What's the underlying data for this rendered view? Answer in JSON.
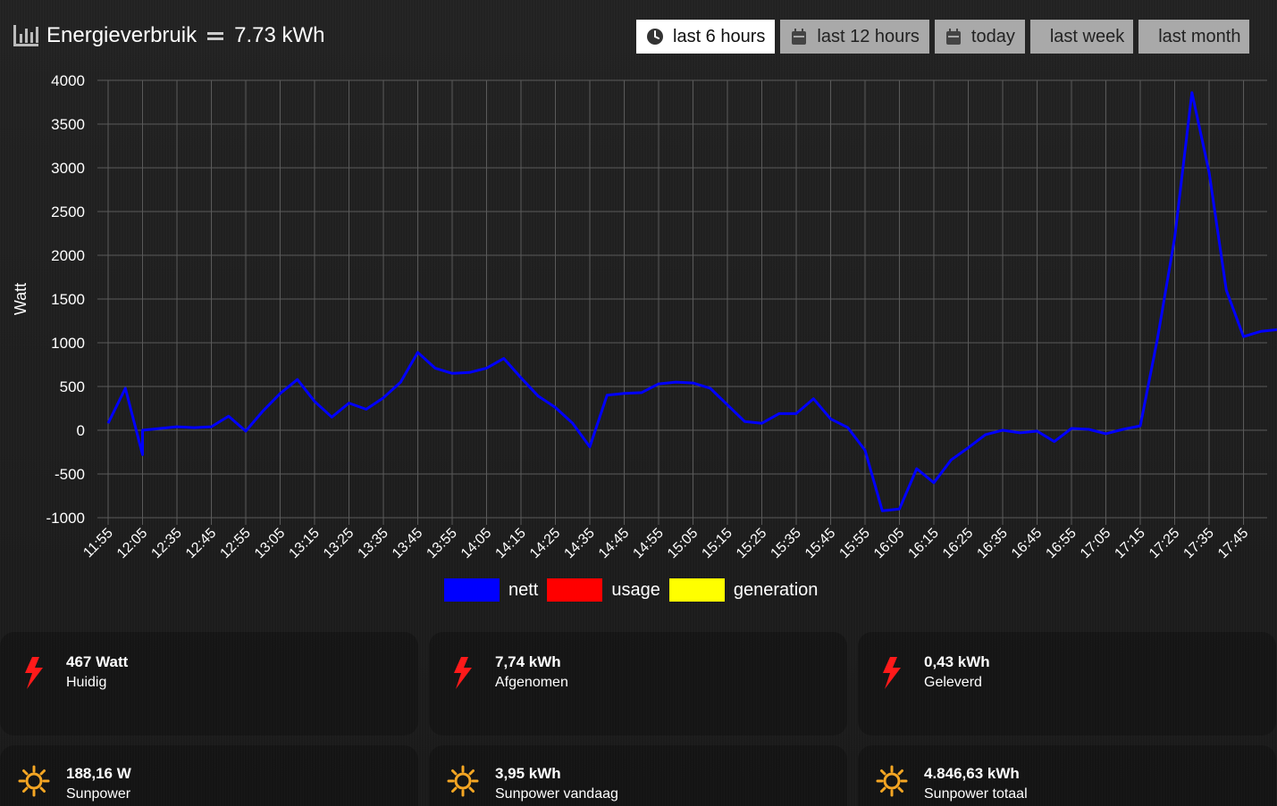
{
  "header": {
    "title": "Energieverbruik",
    "total": "7.73 kWh"
  },
  "range_buttons": [
    {
      "label": "last 6 hours",
      "icon": "clock-icon",
      "active": true
    },
    {
      "label": "last 12 hours",
      "icon": "calendar-icon",
      "active": false
    },
    {
      "label": "today",
      "icon": "calendar-icon",
      "active": false
    },
    {
      "label": "last week",
      "icon": "",
      "active": false
    },
    {
      "label": "last month",
      "icon": "",
      "active": false
    }
  ],
  "chart_data": {
    "type": "line",
    "ylabel": "Watt",
    "ylim": [
      -1000,
      4000
    ],
    "yticks": [
      4000,
      3500,
      3000,
      2500,
      2000,
      1500,
      1000,
      500,
      0,
      -500,
      -1000
    ],
    "xlabels": [
      "11:55",
      "12:05",
      "12:35",
      "12:45",
      "12:55",
      "13:05",
      "13:15",
      "13:25",
      "13:35",
      "13:45",
      "13:55",
      "14:05",
      "14:15",
      "14:25",
      "14:35",
      "14:45",
      "14:55",
      "15:05",
      "15:15",
      "15:25",
      "15:35",
      "15:45",
      "15:55",
      "16:05",
      "16:15",
      "16:25",
      "16:35",
      "16:45",
      "16:55",
      "17:05",
      "17:15",
      "17:25",
      "17:35",
      "17:45"
    ],
    "grid": true,
    "legend_position": "bottom",
    "series": [
      {
        "name": "nett",
        "color": "#0000ff",
        "values": [
          {
            "x": "11:55",
            "y": 80
          },
          {
            "x": "12:00",
            "y": 480
          },
          {
            "x": "12:05",
            "y": -280
          },
          {
            "x": "12:05",
            "y": 0
          },
          {
            "x": "12:35",
            "y": 40
          },
          {
            "x": "12:40",
            "y": 30
          },
          {
            "x": "12:45",
            "y": 40
          },
          {
            "x": "12:50",
            "y": 160
          },
          {
            "x": "12:55",
            "y": -10
          },
          {
            "x": "13:00",
            "y": 220
          },
          {
            "x": "13:05",
            "y": 420
          },
          {
            "x": "13:10",
            "y": 580
          },
          {
            "x": "13:15",
            "y": 330
          },
          {
            "x": "13:20",
            "y": 150
          },
          {
            "x": "13:25",
            "y": 310
          },
          {
            "x": "13:30",
            "y": 240
          },
          {
            "x": "13:35",
            "y": 370
          },
          {
            "x": "13:40",
            "y": 550
          },
          {
            "x": "13:45",
            "y": 890
          },
          {
            "x": "13:50",
            "y": 710
          },
          {
            "x": "13:55",
            "y": 650
          },
          {
            "x": "14:00",
            "y": 660
          },
          {
            "x": "14:05",
            "y": 710
          },
          {
            "x": "14:10",
            "y": 820
          },
          {
            "x": "14:15",
            "y": 600
          },
          {
            "x": "14:20",
            "y": 390
          },
          {
            "x": "14:25",
            "y": 260
          },
          {
            "x": "14:30",
            "y": 80
          },
          {
            "x": "14:35",
            "y": -190
          },
          {
            "x": "14:40",
            "y": 400
          },
          {
            "x": "14:45",
            "y": 420
          },
          {
            "x": "14:50",
            "y": 430
          },
          {
            "x": "14:55",
            "y": 530
          },
          {
            "x": "15:00",
            "y": 550
          },
          {
            "x": "15:05",
            "y": 540
          },
          {
            "x": "15:10",
            "y": 480
          },
          {
            "x": "15:15",
            "y": 290
          },
          {
            "x": "15:20",
            "y": 100
          },
          {
            "x": "15:25",
            "y": 80
          },
          {
            "x": "15:30",
            "y": 190
          },
          {
            "x": "15:35",
            "y": 190
          },
          {
            "x": "15:40",
            "y": 360
          },
          {
            "x": "15:45",
            "y": 130
          },
          {
            "x": "15:50",
            "y": 30
          },
          {
            "x": "15:55",
            "y": -230
          },
          {
            "x": "16:00",
            "y": -920
          },
          {
            "x": "16:05",
            "y": -900
          },
          {
            "x": "16:10",
            "y": -440
          },
          {
            "x": "16:15",
            "y": -600
          },
          {
            "x": "16:20",
            "y": -340
          },
          {
            "x": "16:25",
            "y": -200
          },
          {
            "x": "16:30",
            "y": -50
          },
          {
            "x": "16:35",
            "y": 0
          },
          {
            "x": "16:40",
            "y": -30
          },
          {
            "x": "16:45",
            "y": -10
          },
          {
            "x": "16:50",
            "y": -130
          },
          {
            "x": "16:55",
            "y": 20
          },
          {
            "x": "17:00",
            "y": 10
          },
          {
            "x": "17:05",
            "y": -40
          },
          {
            "x": "17:10",
            "y": 10
          },
          {
            "x": "17:15",
            "y": 50
          },
          {
            "x": "17:20",
            "y": 1050
          },
          {
            "x": "17:25",
            "y": 2200
          },
          {
            "x": "17:30",
            "y": 3860
          },
          {
            "x": "17:35",
            "y": 2950
          },
          {
            "x": "17:40",
            "y": 1600
          },
          {
            "x": "17:45",
            "y": 1070
          },
          {
            "x": "17:50",
            "y": 1130
          },
          {
            "x": "17:55",
            "y": 1150
          }
        ]
      },
      {
        "name": "usage",
        "color": "#ff0000",
        "values": []
      },
      {
        "name": "generation",
        "color": "#ffff00",
        "values": []
      }
    ]
  },
  "tiles": [
    {
      "icon": "lightning-icon",
      "value": "467 Watt",
      "label": "Huidig"
    },
    {
      "icon": "lightning-icon",
      "value": "7,74 kWh",
      "label": "Afgenomen"
    },
    {
      "icon": "lightning-icon",
      "value": "0,43 kWh",
      "label": "Geleverd"
    },
    {
      "icon": "sun-icon",
      "value": "188,16 W",
      "label": "Sunpower"
    },
    {
      "icon": "sun-icon",
      "value": "3,95 kWh",
      "label": "Sunpower vandaag"
    },
    {
      "icon": "sun-icon",
      "value": "4.846,63 kWh",
      "label": "Sunpower totaal"
    }
  ],
  "colors": {
    "accent_lightning": "#ff1a1a",
    "accent_sun": "#f5a623"
  }
}
